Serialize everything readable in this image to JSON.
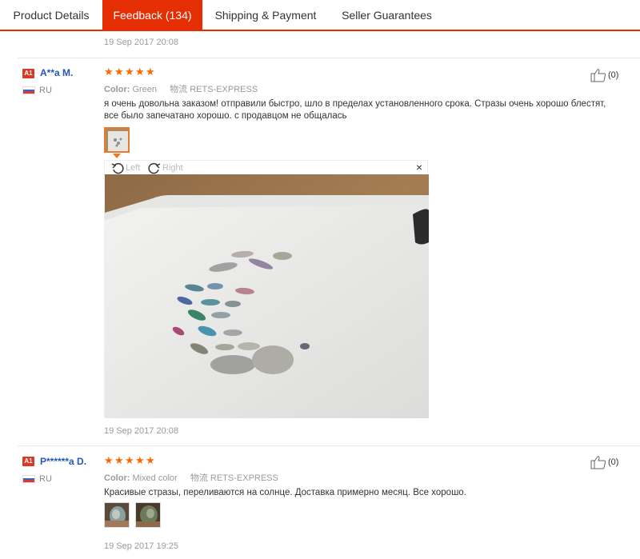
{
  "tabs": [
    {
      "label": "Product Details"
    },
    {
      "label": "Feedback (134)"
    },
    {
      "label": "Shipping & Payment"
    },
    {
      "label": "Seller Guarantees"
    }
  ],
  "top_date": "19 Sep 2017 20:08",
  "reviews": [
    {
      "badge": "A1",
      "user": "A**a M.",
      "country": "RU",
      "rating": 5,
      "color_label": "Color:",
      "color_value": "Green",
      "ship_label": "物流",
      "ship_value": "RETS-EXPRESS",
      "text": "я очень довольна заказом! отправили быстро, шло в пределах установленного срока. Стразы очень хорошо блестят, все было запечатано хорошо. с продавцом не общалась",
      "likes": "(0)",
      "date": "19 Sep 2017 20:08"
    },
    {
      "badge": "A1",
      "user": "P******a D.",
      "country": "RU",
      "rating": 5,
      "color_label": "Color:",
      "color_value": "Mixed color",
      "ship_label": "物流",
      "ship_value": "RETS-EXPRESS",
      "text": "Красивые стразы, переливаются на солнце. Доставка примерно месяц. Все хорошо.",
      "likes": "(0)",
      "date": "19 Sep 2017 19:25"
    }
  ],
  "viewer": {
    "rotate_left": "Left",
    "rotate_right": "Right",
    "close": "×"
  },
  "colors": {
    "accent": "#e62e04",
    "star": "#ff6600",
    "username": "#2356b8"
  }
}
